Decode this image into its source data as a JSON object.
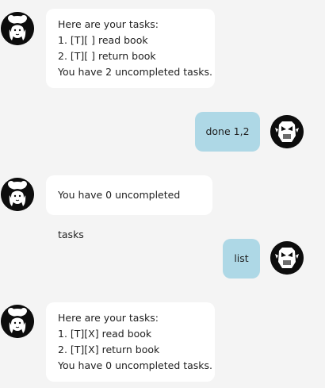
{
  "messages": [
    {
      "sender": "bot",
      "avatar_icon": "chef-girl-avatar-icon",
      "lines": [
        "Here are your tasks:",
        "1. [T][ ] read book",
        "2. [T][ ] return book",
        "You have 2 uncompleted tasks."
      ]
    },
    {
      "sender": "user",
      "avatar_icon": "robot-mask-avatar-icon",
      "lines": [
        "done 1,2"
      ]
    },
    {
      "sender": "bot",
      "avatar_icon": "chef-girl-avatar-icon",
      "lines": [
        "You have 0 uncompleted tasks"
      ]
    },
    {
      "sender": "user",
      "avatar_icon": "robot-mask-avatar-icon",
      "lines": [
        "list"
      ]
    },
    {
      "sender": "bot",
      "avatar_icon": "chef-girl-avatar-icon",
      "lines": [
        "Here are your tasks:",
        "1. [T][X] read book",
        "2. [T][X] return book",
        "You have 0 uncompleted tasks."
      ]
    }
  ],
  "colors": {
    "background": "#f4f4f4",
    "bot_bubble": "#ffffff",
    "user_bubble": "#aed8e6",
    "avatar_bg": "#0d0d0d"
  }
}
